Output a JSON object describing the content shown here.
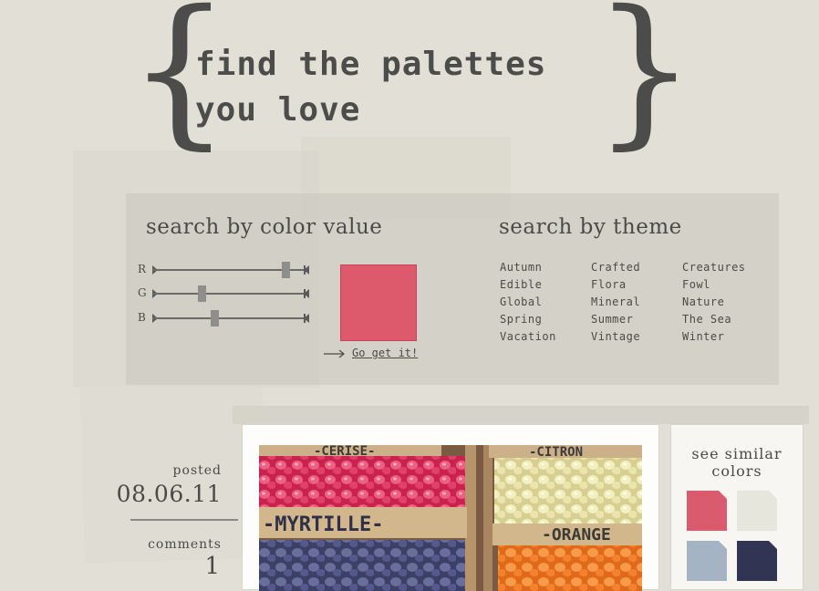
{
  "hero": {
    "title_line1": "find the palettes",
    "title_line2": "you love",
    "brace_open": "{",
    "brace_close": "}"
  },
  "color_search": {
    "title": "search by color value",
    "sliders": [
      {
        "label": "R",
        "value": 216
      },
      {
        "label": "G",
        "value": 80
      },
      {
        "label": "B",
        "value": 101
      }
    ],
    "preview_color": "#dc5a6c",
    "go_label": "Go get it!"
  },
  "theme_search": {
    "title": "search by theme",
    "themes": [
      "Autumn",
      "Crafted",
      "Creatures",
      "Edible",
      "Flora",
      "Fowl",
      "Global",
      "Mineral",
      "Nature",
      "Spring",
      "Summer",
      "The Sea",
      "Vacation",
      "Vintage",
      "Winter"
    ]
  },
  "post": {
    "posted_label": "posted",
    "date": "08.06.11",
    "comments_label": "comments",
    "comment_count": "1"
  },
  "photo": {
    "labels": [
      "-CERISE-",
      "-CITRON",
      "-MYRTILLE-",
      "-ORANGE"
    ]
  },
  "similar": {
    "title_line1": "see similar",
    "title_line2": "colors",
    "swatches": [
      "#d95b6d",
      "#e7e6dc",
      "#a5b4c4",
      "#323453"
    ]
  }
}
